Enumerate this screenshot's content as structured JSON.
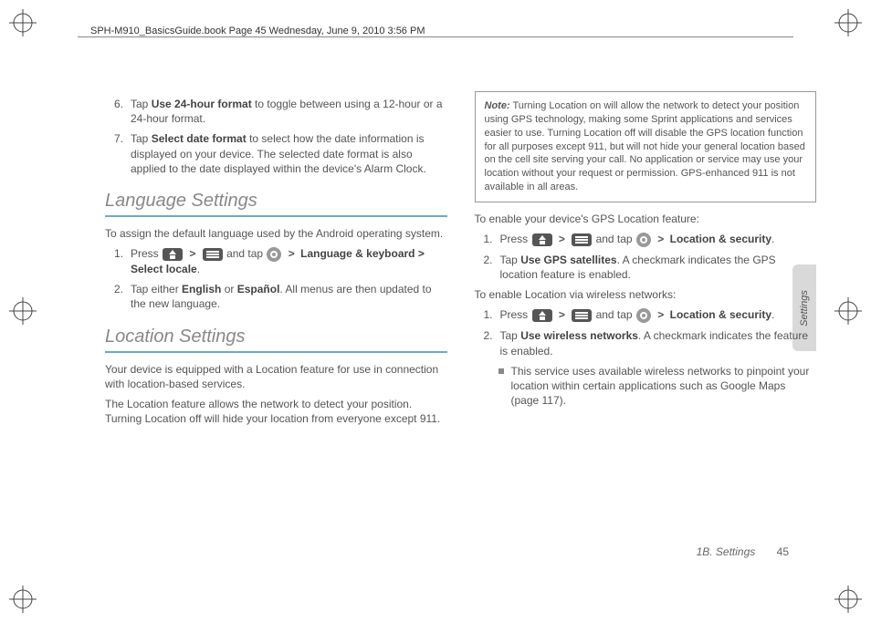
{
  "header": "SPH-M910_BasicsGuide.book  Page 45  Wednesday, June 9, 2010  3:56 PM",
  "left": {
    "step6": {
      "num": "6.",
      "pre": "Tap ",
      "bold": "Use 24-hour format",
      "post": " to toggle between using a 12-hour or a 24-hour format."
    },
    "step7": {
      "num": "7.",
      "pre": "Tap ",
      "bold": "Select date format",
      "post": " to select how the date information is displayed on your device. The selected date format is also applied to the date displayed within the device's Alarm Clock."
    },
    "lang_h": "Language Settings",
    "lang_intro": "To assign the default language used by the Android operating system.",
    "lang1": {
      "num": "1.",
      "pre": "Press ",
      "mid": " and tap ",
      "trail": "Language & keyboard > Select locale",
      "trail_after": "."
    },
    "lang2": {
      "num": "2.",
      "pre": "Tap either ",
      "b1": "English",
      "mid": " or ",
      "b2": "Español",
      "post": ". All menus are then updated to the new language."
    },
    "loc_h": "Location Settings",
    "loc_p1": "Your device is equipped with a Location feature for use in connection with location-based services.",
    "loc_p2": "The Location feature allows the network to detect your position. Turning Location off will hide your location from everyone except 911."
  },
  "right": {
    "note_label": "Note:",
    "note_body": "Turning Location on will allow the network to detect your position using GPS technology, making some Sprint applications and services easier to use. Turning Location off will disable the GPS location function for all purposes except 911, but will not hide your general location based on the cell site serving your call. No application or service may use your location without your request or permission. GPS-enhanced 911 is not available in all areas.",
    "gps_heading": "To enable your device's GPS Location feature:",
    "gps1": {
      "num": "1.",
      "pre": "Press ",
      "mid": " and tap ",
      "trail": "Location & security",
      "trail_after": "."
    },
    "gps2": {
      "num": "2.",
      "pre": "Tap ",
      "bold": "Use GPS satellites",
      "post": ". A checkmark indicates the GPS location feature is enabled."
    },
    "wl_heading": "To enable Location via wireless networks:",
    "wl1": {
      "num": "1.",
      "pre": "Press ",
      "mid": " and tap ",
      "trail": "Location & security",
      "trail_after": "."
    },
    "wl2": {
      "num": "2.",
      "pre": "Tap ",
      "bold": "Use wireless networks",
      "post": ". A checkmark indicates the feature is enabled."
    },
    "wl_sub": "This service uses available wireless networks to pinpoint your location within certain applications such as Google Maps (page 117)."
  },
  "sidetab": "Settings",
  "footer": {
    "section": "1B. Settings",
    "page": "45"
  }
}
